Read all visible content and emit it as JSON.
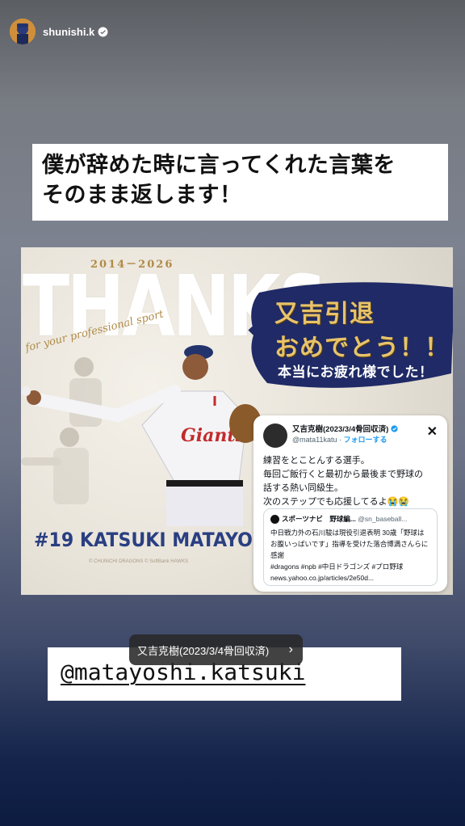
{
  "header": {
    "username": "shunishi.k",
    "verified": true,
    "avatar_icon": "user-avatar"
  },
  "caption": {
    "line1": "僕が辞めた時に言ってくれた言葉を",
    "line2": "そのまま返します！"
  },
  "graphic": {
    "years": "2014－2026",
    "thanks": "THANKS",
    "script": "for your professional sport",
    "congrats_line1": "又吉引退",
    "congrats_line2": "おめでとう！！",
    "thanks_jp": "本当にお疲れ様でした！",
    "player_name": "#19 KATSUKI MATAYOSHI",
    "credits": "© CHUNICHI DRAGONS    © SoftBank HAWKS",
    "accent_gold": "#b08a47",
    "accent_navy": "#2a3f82"
  },
  "tweet": {
    "name": "又吉克樹(2023/3/4骨回収済)",
    "handle": "@mata11katu",
    "follow": "フォローする",
    "body_line1": "練習をとことんする選手。",
    "body_line2": "毎回ご飯行くと最初から最後まで野球の",
    "body_line3": "話する熱い同級生。",
    "body_line4": "次のステップでも応援してるよ😭😭",
    "quote_name": "スポーツナビ　野球編...",
    "quote_handle": "@sn_baseball...",
    "quote_line1": "中日戦力外の石川駿は現役引退表明 30歳「野球は",
    "quote_line2": "お腹いっぱいです」指導を受けた落合博満さんらに",
    "quote_line3": "感謝",
    "quote_line4": "#dragons #npb #中日ドラゴンズ #プロ野球",
    "quote_line5": "news.yahoo.co.jp/articles/2e50d..."
  },
  "link_sticker": {
    "label": "又吉克樹(2023/3/4骨回収済)",
    "chevron": "›"
  },
  "mention": {
    "text": "@matayoshi.katsuki"
  }
}
